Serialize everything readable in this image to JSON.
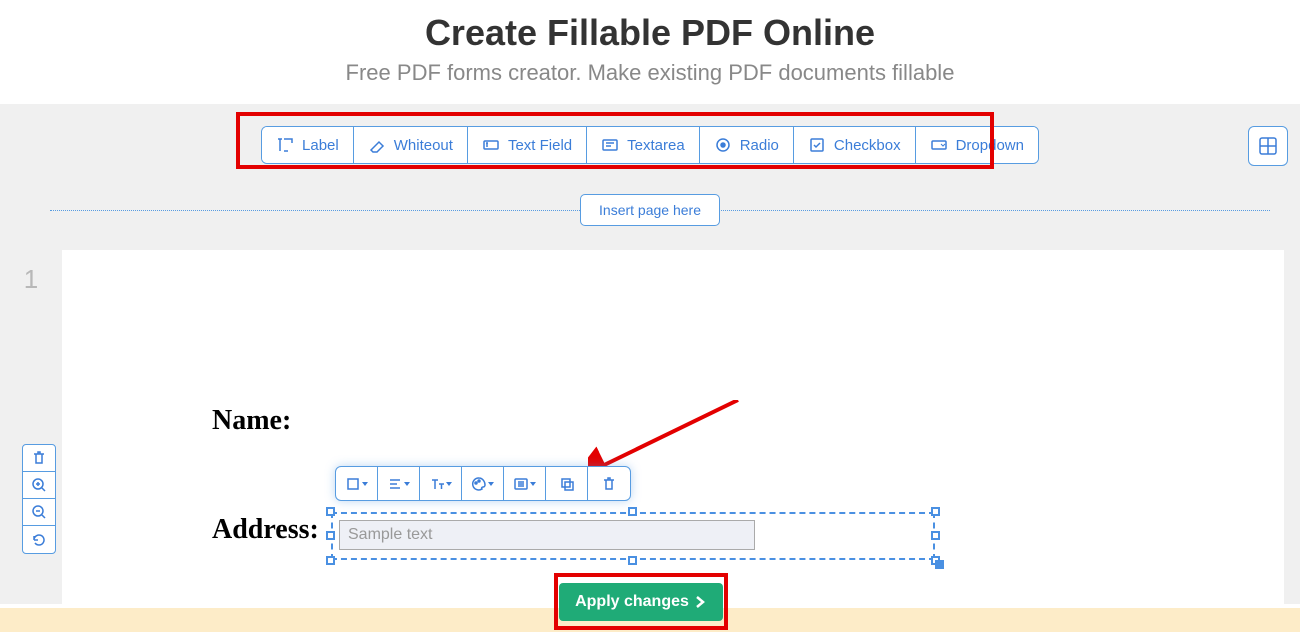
{
  "header": {
    "title": "Create Fillable PDF Online",
    "subtitle": "Free PDF forms creator. Make existing PDF documents fillable"
  },
  "toolbar": {
    "label": "Label",
    "whiteout": "Whiteout",
    "text_field": "Text Field",
    "textarea": "Textarea",
    "radio": "Radio",
    "checkbox": "Checkbox",
    "dropdown": "Dropdown"
  },
  "insert_page": "Insert page here",
  "page_number": "1",
  "form": {
    "name_label": "Name:",
    "address_label": "Address:",
    "sample_placeholder": "Sample text"
  },
  "apply_button": "Apply changes"
}
